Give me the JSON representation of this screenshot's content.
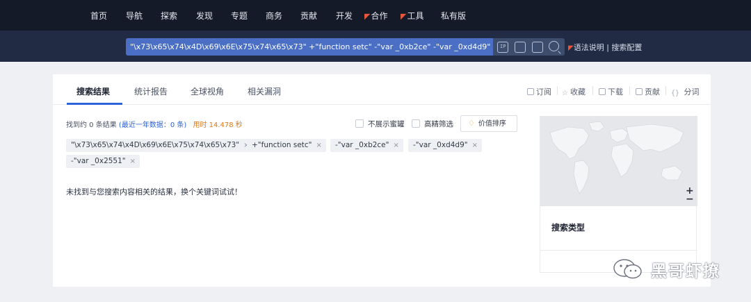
{
  "nav": {
    "items": [
      {
        "label": "首页",
        "badge": false
      },
      {
        "label": "导航",
        "badge": false
      },
      {
        "label": "探索",
        "badge": false
      },
      {
        "label": "发现",
        "badge": false
      },
      {
        "label": "专题",
        "badge": false
      },
      {
        "label": "商务",
        "badge": false
      },
      {
        "label": "贡献",
        "badge": false
      },
      {
        "label": "开发",
        "badge": false
      },
      {
        "label": "合作",
        "badge": true
      },
      {
        "label": "工具",
        "badge": true
      },
      {
        "label": "私有版",
        "badge": false
      }
    ]
  },
  "search": {
    "query": "\"\\x73\\x65\\x74\\x4D\\x69\\x6E\\x75\\x74\\x65\\x73\" +\"function setc\" -\"var _0xb2ce\" -\"var _0xd4d9\" -\"var _0x2551\"",
    "icons": [
      "ip-icon",
      "scan-icon",
      "camera-icon",
      "search-icon"
    ],
    "ip_label": "IP",
    "syntax_link": "语法说明",
    "divider": "|",
    "config_link": "搜索配置"
  },
  "tabs": [
    {
      "label": "搜索结果",
      "active": true
    },
    {
      "label": "统计报告",
      "active": false
    },
    {
      "label": "全球视角",
      "active": false
    },
    {
      "label": "相关漏洞",
      "active": false
    }
  ],
  "actions": {
    "subscribe": "订阅",
    "collect": "收藏",
    "download": "下载",
    "contribute": "贡献",
    "share": "分词"
  },
  "results": {
    "count_text": "找到约 0 条结果",
    "recent_text": "(最近一年数据：0 条)",
    "time_text": "用时 14.478 秒",
    "hide_honeypot": "不展示蜜罐",
    "precise_filter": "高精筛选",
    "value_sort": "价值排序",
    "empty_message": "未找到与您搜索内容相关的结果，换个关键词试试！"
  },
  "chips": [
    "\"\\x73\\x65\\x74\\x4D\\x69\\x6E\\x75\\x74\\x65\\x73\"",
    "+\"function setc\"",
    "-\"var _0xb2ce\"",
    "-\"var _0xd4d9\"",
    "-\"var _0x2551\""
  ],
  "chip_close": "×",
  "map": {
    "zoom_in": "+",
    "zoom_out": "−"
  },
  "right_panel": {
    "title": "搜索类型"
  },
  "watermark": {
    "text": "黑哥虾撩"
  },
  "colors": {
    "nav_bg": "#141a28",
    "search_bg": "#212c44",
    "query_highlight": "#4a6fc4",
    "accent_blue": "#2b63d6",
    "time_orange": "#e07b18",
    "badge_red": "#e8563b"
  }
}
